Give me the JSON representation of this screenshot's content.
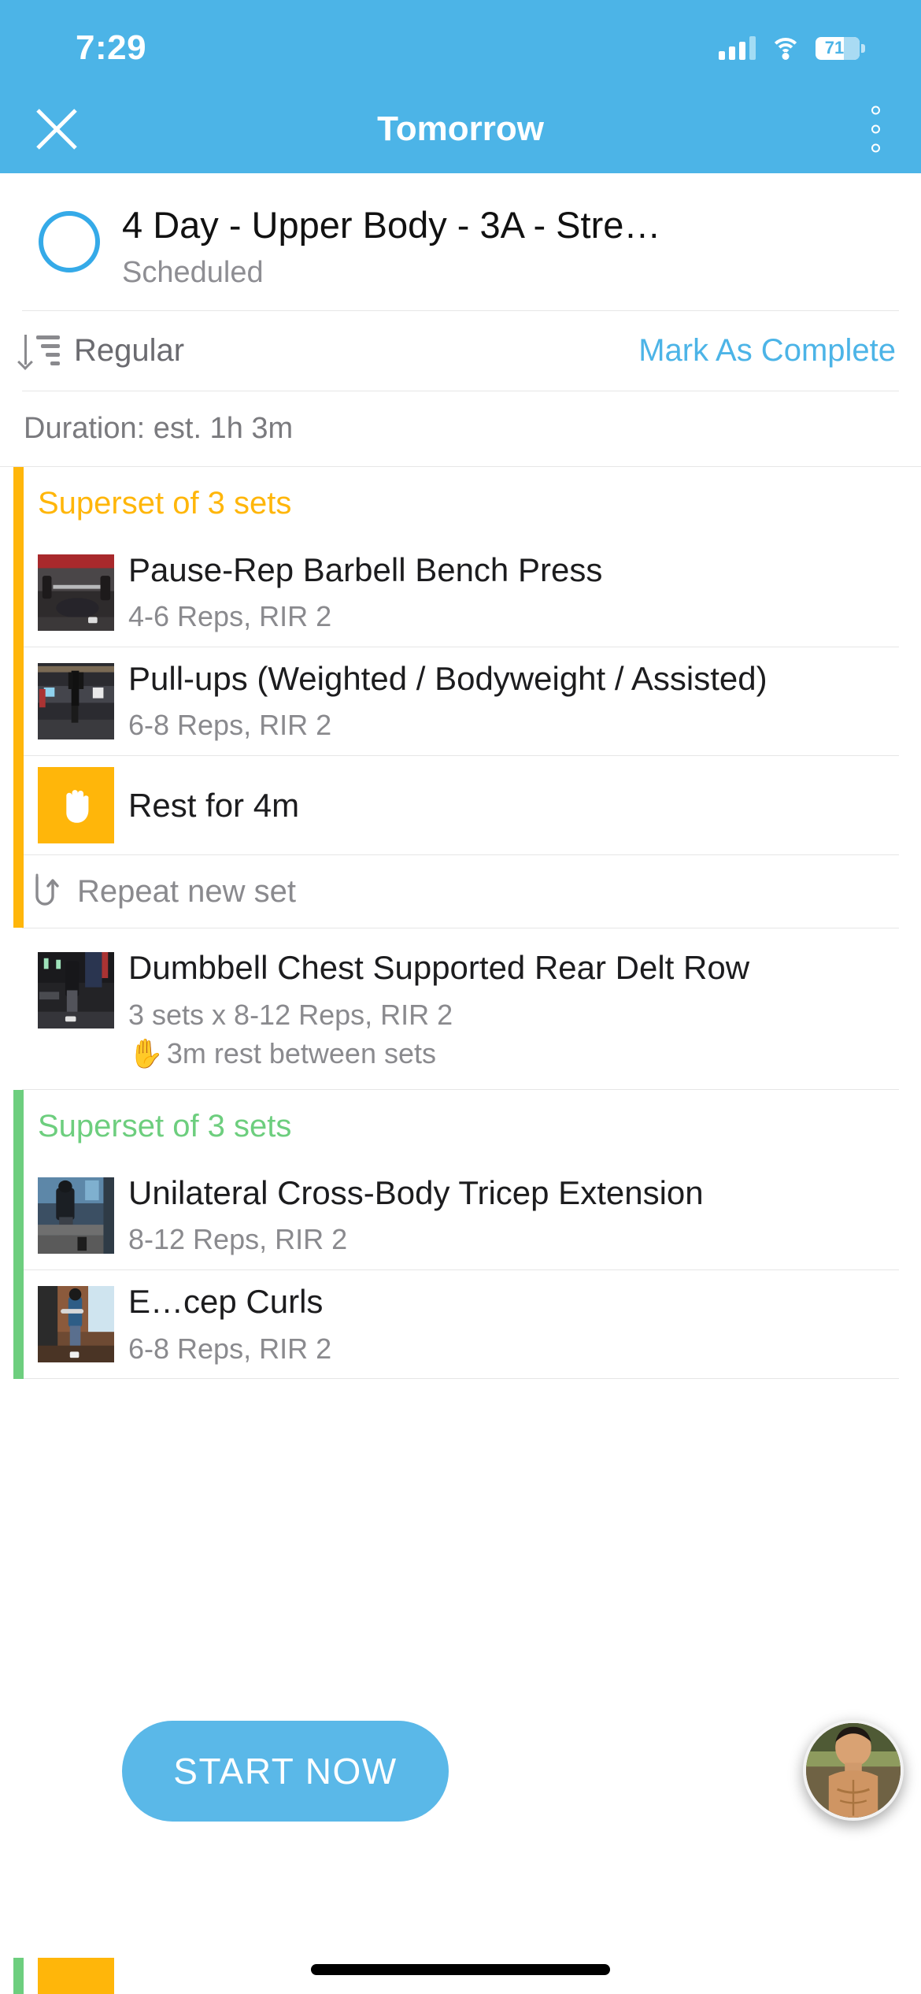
{
  "status_bar": {
    "time": "7:29",
    "battery_percent": "71",
    "cell_icon": "cellular-signal-icon",
    "wifi_icon": "wifi-icon",
    "battery_icon": "battery-icon"
  },
  "nav": {
    "title": "Tomorrow",
    "close_icon": "close-icon",
    "more_icon": "more-options-icon"
  },
  "workout": {
    "title": "4 Day - Upper Body - 3A - Stre…",
    "status": "Scheduled",
    "checkbox_icon": "empty-circle-icon"
  },
  "toolbar": {
    "sort_label": "Regular",
    "sort_icon": "sort-descending-icon",
    "mark_complete_label": "Mark As Complete"
  },
  "duration": {
    "label": "Duration: est. 1h 3m"
  },
  "sections": [
    {
      "type": "superset",
      "accent": "#ffb60a",
      "title": "Superset of 3 sets",
      "items": [
        {
          "kind": "exercise",
          "name": "Pause-Rep Barbell Bench Press",
          "meta": "4-6 Reps, RIR 2",
          "thumb": "bench-press-thumbnail"
        },
        {
          "kind": "exercise",
          "name": "Pull-ups (Weighted / Bodyweight / Assisted)",
          "meta": "6-8 Reps, RIR 2",
          "thumb": "pull-up-thumbnail"
        },
        {
          "kind": "rest",
          "label": "Rest for 4m",
          "icon": "hand-stop-icon"
        },
        {
          "kind": "repeat",
          "label": "Repeat new set",
          "icon": "repeat-icon"
        }
      ]
    },
    {
      "type": "single",
      "items": [
        {
          "kind": "exercise",
          "name": "Dumbbell Chest Supported Rear Delt Row",
          "meta": "3 sets x 8-12 Reps, RIR 2",
          "rest_note": "3m rest between sets",
          "rest_icon": "hand-stop-icon",
          "thumb": "rear-delt-row-thumbnail"
        }
      ]
    },
    {
      "type": "superset",
      "accent": "#6dce7e",
      "title": "Superset of 3 sets",
      "items": [
        {
          "kind": "exercise",
          "name": "Unilateral Cross-Body Tricep Extension",
          "meta": "8-12 Reps, RIR 2",
          "thumb": "tricep-extension-thumbnail"
        },
        {
          "kind": "exercise",
          "name": "E…cep Curls",
          "meta": "6-8 Reps, RIR 2",
          "thumb": "bicep-curl-thumbnail"
        }
      ]
    }
  ],
  "start_button": {
    "label": "START NOW"
  },
  "avatar": {
    "icon": "user-avatar"
  },
  "colors": {
    "brand_blue": "#4cb4e7",
    "superset_orange": "#ffb60a",
    "superset_green": "#6dce7e",
    "link_blue": "#4cb4e7",
    "muted_text": "#8a8a8e"
  }
}
